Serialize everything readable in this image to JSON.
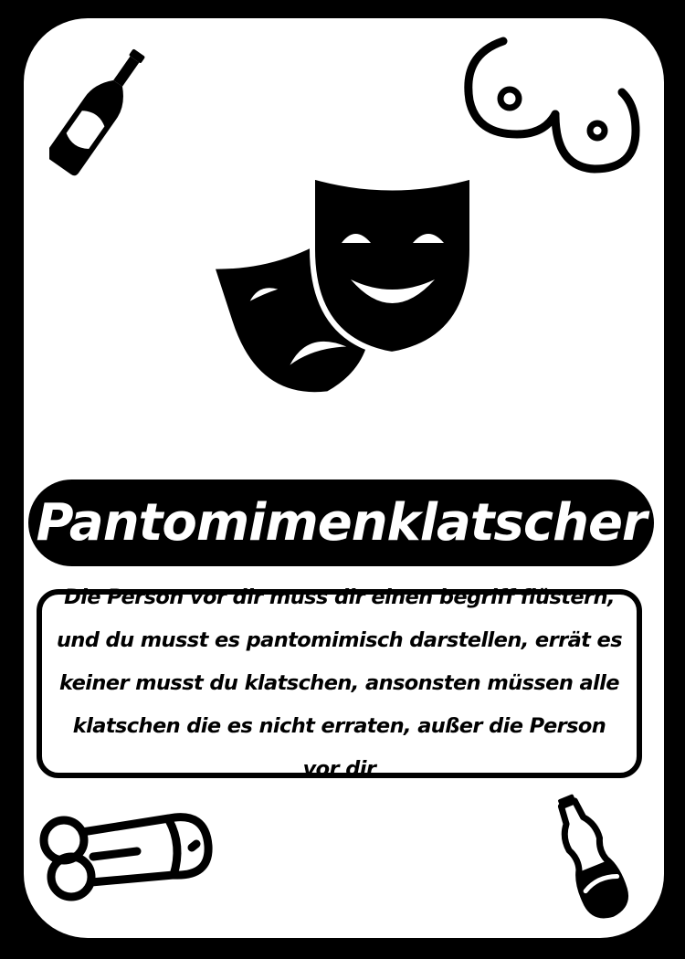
{
  "card": {
    "title": "Pantomimenklatscher",
    "description": "Die Person vor dir muss dir einen begriff flüstern, und du musst es pantomimisch darstellen, errät es keiner musst du klatschen, ansonsten müssen alle klatschen die es nicht erraten, außer die Person vor dir"
  },
  "icons": {
    "top_left": "beer-bottle-icon",
    "top_right": "breasts-icon",
    "center": "theater-masks-icon",
    "bottom_left": "penis-icon",
    "bottom_right": "cola-bottle-icon"
  },
  "colors": {
    "background": "#000000",
    "card": "#ffffff",
    "ink": "#000000"
  }
}
